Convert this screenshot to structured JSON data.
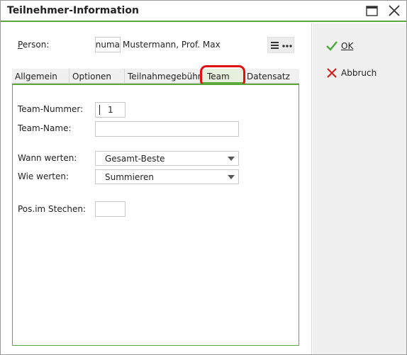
{
  "window": {
    "title": "Teilnehmer-Information"
  },
  "person": {
    "label": "Person:",
    "code": "numa",
    "name": "Mustermann, Prof. Max"
  },
  "tabs": [
    {
      "label": "Allgemein"
    },
    {
      "label": "Optionen"
    },
    {
      "label": "Teilnahmegebühr"
    },
    {
      "label": "Team"
    },
    {
      "label": "Datensatz"
    }
  ],
  "active_tab": "Team",
  "team": {
    "nummer_label": "Team-Nummer:",
    "nummer_value": "1",
    "name_label": "Team-Name:",
    "name_value": "",
    "wann_label": "Wann werten:",
    "wann_value": "Gesamt-Beste",
    "wie_label": "Wie werten:",
    "wie_value": "Summieren",
    "pos_label": "Pos.im Stechen:",
    "pos_value": ""
  },
  "actions": {
    "ok_label": "OK",
    "cancel_label": "Abbruch"
  },
  "colors": {
    "accent": "#5aa83a",
    "highlight": "#e01010"
  },
  "icons": [
    "maximize-icon",
    "close-icon",
    "hamburger-icon",
    "more-icon",
    "check-icon",
    "cross-icon"
  ]
}
